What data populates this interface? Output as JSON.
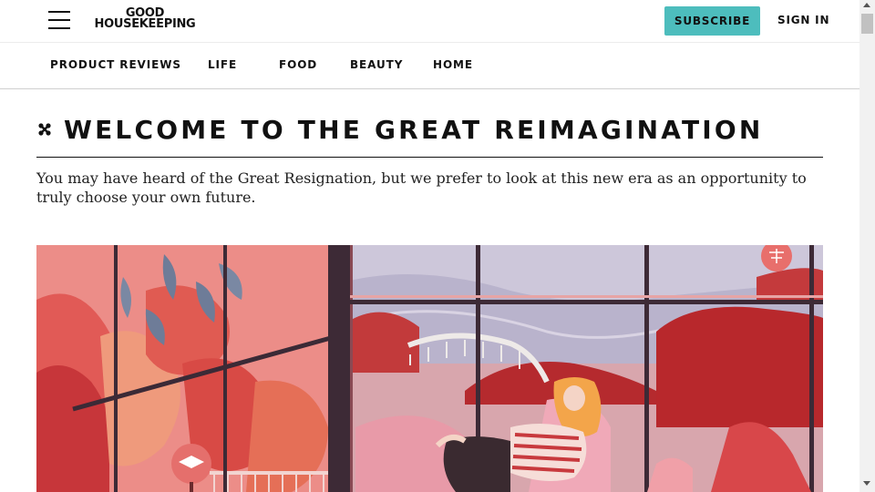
{
  "header": {
    "logo_line1": "GOOD",
    "logo_line2": "HOUSEKEEPING",
    "subscribe_label": "SUBSCRIBE",
    "signin_label": "SIGN IN",
    "menu_icon": "hamburger-menu-icon"
  },
  "nav": {
    "items": [
      {
        "label": "PRODUCT REVIEWS"
      },
      {
        "label": "LIFE"
      },
      {
        "label": "FOOD"
      },
      {
        "label": "BEAUTY"
      },
      {
        "label": "HOME"
      }
    ]
  },
  "article": {
    "headline": "WELCOME TO THE GREAT REIMAGINATION",
    "headline_icon": "sparkle-icon",
    "dek": "You may have heard of the Great Resignation, but we prefer to look at this new era as an opportunity to truly choose your own future."
  },
  "hero": {
    "description_icon": "illustration",
    "icons": [
      "graduation-cap-sign-icon",
      "scales-sign-icon"
    ]
  },
  "colors": {
    "accent": "#4dbdbd",
    "text": "#111111",
    "hero_salmon": "#e87a78",
    "hero_dark_red": "#b5282b",
    "hero_sky": "#b7b4cf"
  }
}
